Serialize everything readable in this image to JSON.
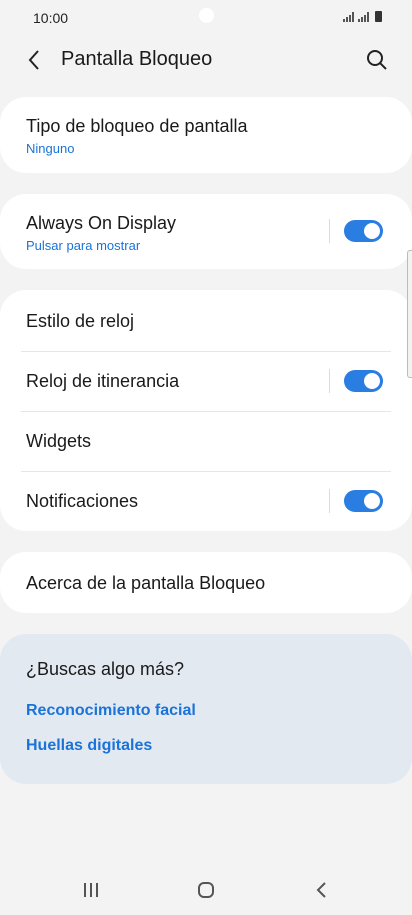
{
  "status_bar": {
    "time": "10:00"
  },
  "header": {
    "title": "Pantalla Bloqueo"
  },
  "lock_type": {
    "title": "Tipo de bloqueo de pantalla",
    "value": "Ninguno"
  },
  "always_on": {
    "title": "Always On Display",
    "subtitle": "Pulsar para mostrar",
    "enabled": true
  },
  "settings_group": {
    "clock_style": "Estilo de reloj",
    "roaming_clock": "Reloj de itinerancia",
    "widgets": "Widgets",
    "notifications": "Notificaciones"
  },
  "about": {
    "title": "Acerca de la pantalla Bloqueo"
  },
  "suggestions": {
    "title": "¿Buscas algo más?",
    "links": [
      "Reconocimiento facial",
      "Huellas digitales"
    ]
  },
  "colors": {
    "accent": "#2a7de1",
    "link": "#1a73d9",
    "background": "#f3f3f3",
    "suggest_bg": "#e3e9f0"
  }
}
